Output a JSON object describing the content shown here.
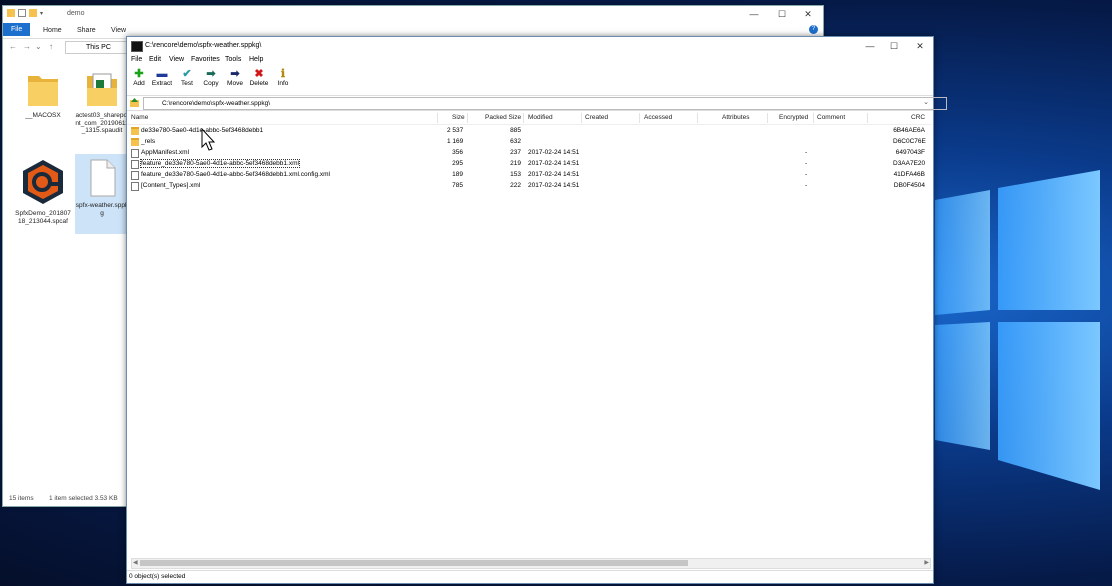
{
  "explorer": {
    "title": "demo",
    "ribbon": [
      "File",
      "Home",
      "Share",
      "View"
    ],
    "address_label": "This PC",
    "icons": [
      {
        "label": "__MACOSX",
        "type": "folder"
      },
      {
        "label": "actest03_sharepoint_com_20190611_1315.spaudit",
        "type": "folder-file"
      },
      {
        "label": "SpfxDemo_20180718_213044.spcaf",
        "type": "app"
      },
      {
        "label": "spfx-weather.sppkg",
        "type": "file"
      }
    ],
    "status_items": "15 items",
    "status_selected": "1 item selected  3.53 KB",
    "minimize": "—",
    "maximize": "☐",
    "close": "✕",
    "help": "?"
  },
  "zip": {
    "title": "C:\\rencore\\demo\\spfx-weather.sppkg\\",
    "menu": [
      "File",
      "Edit",
      "View",
      "Favorites",
      "Tools",
      "Help"
    ],
    "toolbar": [
      {
        "label": "Add",
        "glyph": "✚",
        "color": "#1aa31a"
      },
      {
        "label": "Extract",
        "glyph": "▬",
        "color": "#1f3a9a"
      },
      {
        "label": "Test",
        "glyph": "✔",
        "color": "#2a9aa8"
      },
      {
        "label": "Copy",
        "glyph": "➡",
        "color": "#1a6a5a"
      },
      {
        "label": "Move",
        "glyph": "➡",
        "color": "#1a2a6a"
      },
      {
        "label": "Delete",
        "glyph": "✖",
        "color": "#d01818"
      },
      {
        "label": "Info",
        "glyph": "ℹ",
        "color": "#b08a10"
      }
    ],
    "path": "C:\\rencore\\demo\\spfx-weather.sppkg\\",
    "columns": [
      "Name",
      "Size",
      "Packed Size",
      "Modified",
      "Created",
      "Accessed",
      "Attributes",
      "Encrypted",
      "Comment",
      "CRC"
    ],
    "rows": [
      {
        "name": "de33e780-5ae0-4d1e-abbc-5ef3468debb1",
        "size": "2 537",
        "packed": "885",
        "modified": "",
        "encrypted": "",
        "crc": "6B46AE6A",
        "type": "folder"
      },
      {
        "name": "_rels",
        "size": "1 169",
        "packed": "632",
        "modified": "",
        "encrypted": "",
        "crc": "D6C0C76E",
        "type": "folder"
      },
      {
        "name": "AppManifest.xml",
        "size": "356",
        "packed": "237",
        "modified": "2017-02-24 14:51",
        "encrypted": "-",
        "crc": "6497043F",
        "type": "file"
      },
      {
        "name": "feature_de33e780-5ae0-4d1e-abbc-5ef3468debb1.xml",
        "size": "295",
        "packed": "219",
        "modified": "2017-02-24 14:51",
        "encrypted": "-",
        "crc": "D3AA7E20",
        "type": "file"
      },
      {
        "name": "feature_de33e780-5ae0-4d1e-abbc-5ef3468debb1.xml.config.xml",
        "size": "189",
        "packed": "153",
        "modified": "2017-02-24 14:51",
        "encrypted": "-",
        "crc": "41DFA46B",
        "type": "file"
      },
      {
        "name": "[Content_Types].xml",
        "size": "785",
        "packed": "222",
        "modified": "2017-02-24 14:51",
        "encrypted": "-",
        "crc": "DB0F4504",
        "type": "file"
      }
    ],
    "status": "0 object(s) selected",
    "minimize": "—",
    "maximize": "☐",
    "close": "✕"
  },
  "colors": {
    "accent": "#1d6fce",
    "folder": "#f4c24d"
  }
}
